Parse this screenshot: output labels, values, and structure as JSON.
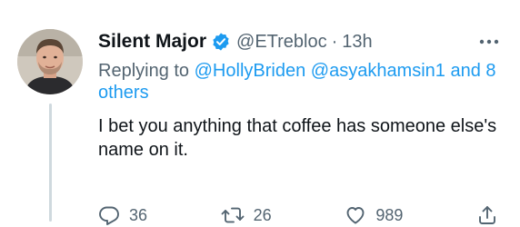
{
  "tweet": {
    "author_name": "Silent Major",
    "handle": "@ETrebloc",
    "separator": "·",
    "time": "13h",
    "verified": true,
    "replying_prefix": "Replying to",
    "mention_1": "@HollyBriden",
    "mention_2": "@asyakhamsin1",
    "and_word": "and",
    "others": "8 others",
    "text": "I bet you anything that coffee has someone else's name on it."
  },
  "actions": {
    "replies": "36",
    "retweets": "26",
    "likes": "989"
  },
  "icons": {
    "verified": "verified-badge-icon",
    "more": "more-horizontal-icon",
    "reply": "reply-icon",
    "retweet": "retweet-icon",
    "like": "heart-icon",
    "share": "share-icon"
  },
  "colors": {
    "accent": "#1d9bf0",
    "text": "#0f1419",
    "secondary": "#536471",
    "thread_line": "#cfd9de"
  }
}
